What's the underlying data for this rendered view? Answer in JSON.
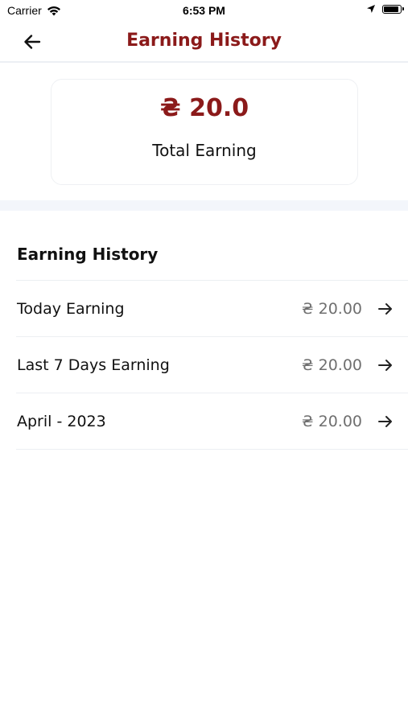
{
  "status_bar": {
    "carrier": "Carrier",
    "time": "6:53 PM"
  },
  "header": {
    "title": "Earning History"
  },
  "summary": {
    "amount": "₴ 20.0",
    "label": "Total Earning"
  },
  "section": {
    "title": "Earning History"
  },
  "items": [
    {
      "label": "Today Earning",
      "amount": "₴ 20.00"
    },
    {
      "label": "Last 7 Days Earning",
      "amount": "₴ 20.00"
    },
    {
      "label": "April - 2023",
      "amount": "₴ 20.00"
    }
  ],
  "colors": {
    "accent": "#8b1a1a",
    "amount_gray": "#6f6f6f",
    "divider": "#eceff2",
    "band": "#f3f6fb"
  },
  "icons": {
    "back": "arrow-left-icon",
    "row_arrow": "arrow-right-icon",
    "wifi": "wifi-icon",
    "location": "location-arrow-icon",
    "battery": "battery-icon"
  }
}
